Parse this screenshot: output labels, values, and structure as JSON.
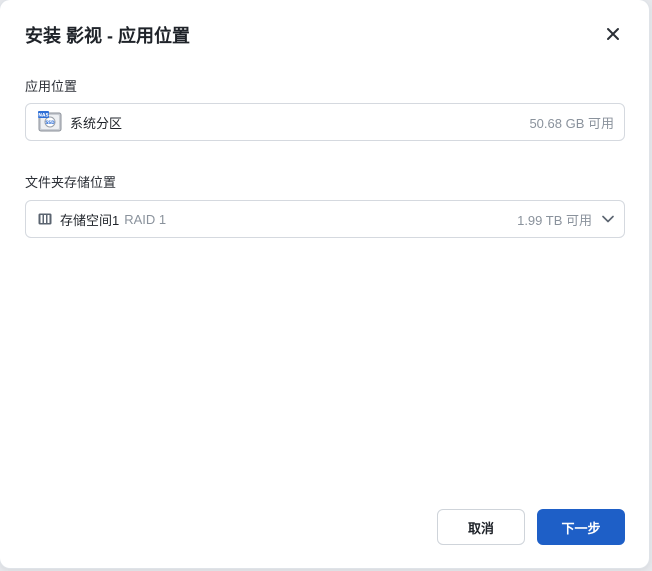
{
  "dialog": {
    "title": "安装 影视 - 应用位置",
    "close_icon": "close-icon"
  },
  "app_location": {
    "label": "应用位置",
    "volume_name": "系统分区",
    "available": "50.68 GB 可用",
    "icon": "ssd-drive-icon",
    "icon_text": "SSD"
  },
  "folder_location": {
    "label": "文件夹存储位置",
    "volume_name": "存储空间1",
    "raid": "RAID 1",
    "available": "1.99 TB 可用",
    "icon": "storage-pool-icon",
    "chevron": "chevron-down-icon"
  },
  "buttons": {
    "cancel": "取消",
    "next": "下一步"
  },
  "colors": {
    "primary": "#1e5fc7",
    "muted_text": "#8a929c",
    "border": "#d5d9df"
  }
}
